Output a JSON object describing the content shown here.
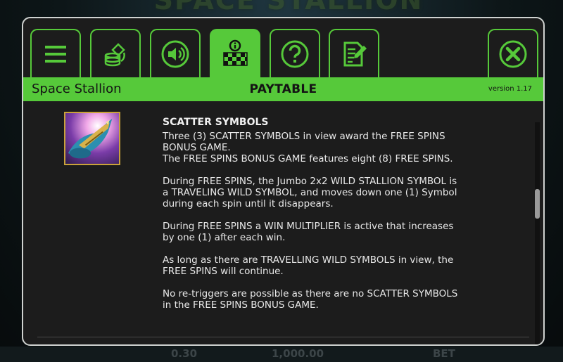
{
  "game_name": "Space Stallion",
  "panel_title": "PAYTABLE",
  "version": "version 1.17",
  "colors": {
    "accent": "#56c93a",
    "dialog_bg": "#1c1c1c",
    "frame_border": "#cfd2d0",
    "text": "#e8e8e8"
  },
  "tabs": [
    {
      "icon": "menu-icon",
      "active": false
    },
    {
      "icon": "bet-settings-icon",
      "active": false
    },
    {
      "icon": "sound-icon",
      "active": false
    },
    {
      "icon": "paytable-info-icon",
      "active": true
    },
    {
      "icon": "help-icon",
      "active": false
    },
    {
      "icon": "history-icon",
      "active": false
    }
  ],
  "close_icon": "close-icon",
  "symbol_icon": "scatter-symbol-icon",
  "section": {
    "heading": "SCATTER SYMBOLS",
    "paragraphs": [
      "Three (3) SCATTER SYMBOLS in view award the FREE SPINS\nBONUS GAME.\nThe FREE SPINS BONUS GAME features eight (8) FREE SPINS.",
      "During FREE SPINS, the Jumbo 2x2 WILD STALLION SYMBOL is\na TRAVELING WILD SYMBOL, and moves down one (1) Symbol\nduring each spin until it disappears.",
      "During FREE SPINS a WIN MULTIPLIER is active that increases\nby one (1) after each  win.",
      "As long as there are TRAVELLING WILD SYMBOLS in view, the\nFREE SPINS will continue.",
      "No re-triggers are possible as there are no SCATTER SYMBOLS\nin the FREE SPINS BONUS GAME."
    ]
  },
  "background": {
    "title": "SPACE STALLION",
    "bottom_values": [
      "0.30",
      "1,000.00",
      "BET"
    ]
  },
  "scroll_position": 0.33
}
